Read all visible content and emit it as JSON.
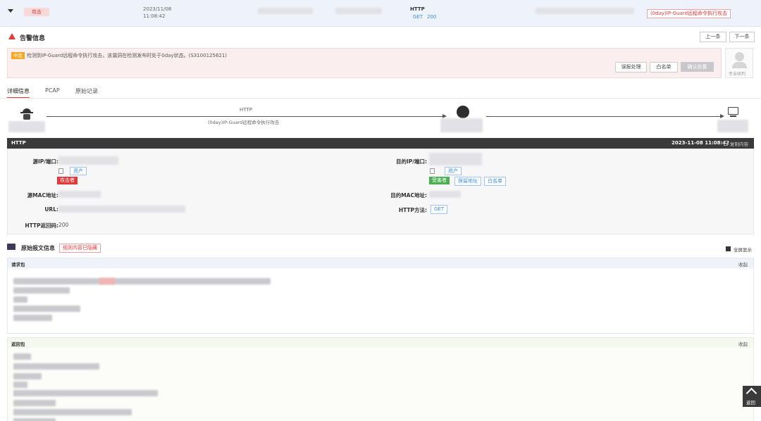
{
  "alert_row": {
    "tag": "攻击",
    "date": "2023/11/08",
    "time": "11:08:42",
    "protocol": "HTTP",
    "method": "GET",
    "status": "200",
    "event_tag": "(0day)IP-Guard远程命令执行攻击"
  },
  "alert_info": {
    "title": "告警信息",
    "prev": "上一条",
    "next": "下一条",
    "severity": "中危",
    "message": "检测到IP-Guard远程命令执行攻击，该漏洞在检测发布时处于0day状态。(S3100125621)",
    "btn_report": "误报处理",
    "btn_whitelist": "白名单",
    "btn_confirm": "确认处置",
    "expert_label": "专业研判"
  },
  "tabs": [
    "详细信息",
    "PCAP",
    "原始记录"
  ],
  "flow": {
    "protocol": "HTTP",
    "attack_name": "(0day)IP-Guard远程命令执行攻击"
  },
  "http_bar": {
    "title": "HTTP",
    "datetime": "2023-11-08 11:08:42",
    "copy": "复制内容"
  },
  "details": {
    "src_label": "源IP/端口:",
    "src_link": "资产",
    "attacker_tag": "攻击者",
    "dst_label": "目的IP/端口:",
    "dst_link": "资产",
    "victim_tag": "受害者",
    "retain_tag": "保留地址",
    "white_tag": "白名单",
    "src_mac_label": "源MAC地址:",
    "dst_mac_label": "目的MAC地址:",
    "url_label": "URL:",
    "method_label": "HTTP方法:",
    "method_value": "GET",
    "code_label": "HTTP返回码:",
    "code_value": "200"
  },
  "raw": {
    "title": "原始报文信息",
    "warn_tag": "规则内容已隐藏",
    "fullscreen": "全屏显示",
    "req_label": "请求包",
    "req_collapse": "收起",
    "resp_label": "返回包",
    "resp_collapse": "收起"
  },
  "back_top": "返回",
  "colors": {
    "attack": "#e23a3a",
    "info": "#3b8ee8",
    "victim": "#4caf50",
    "header_bar": "#3a3a3a"
  }
}
